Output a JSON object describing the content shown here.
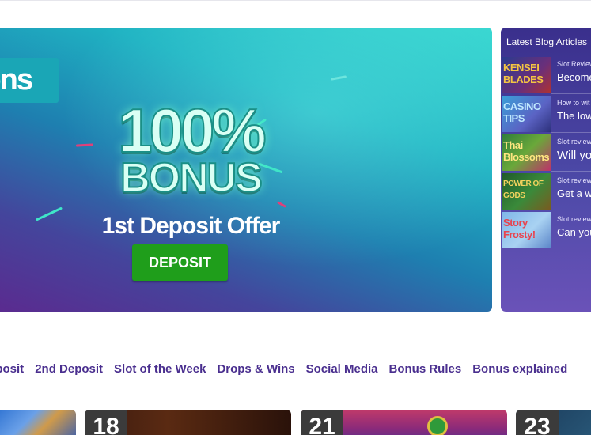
{
  "banner": {
    "ribbon_text": "ons",
    "bonus_percent": "100%",
    "bonus_word": "BONUS",
    "offer_text": "1st Deposit Offer",
    "deposit_button": "DEPOSIT"
  },
  "blog": {
    "title": "Latest Blog Articles",
    "items": [
      {
        "thumb_text": "KENSEI BLADES",
        "category": "Slot Review",
        "headline": "Become"
      },
      {
        "thumb_text": "CASINO TIPS",
        "category": "How to wit",
        "headline": "The low"
      },
      {
        "thumb_text": "Thai Blossoms",
        "category": "Slot review",
        "headline": "Will yo"
      },
      {
        "thumb_text": "POWER OF GODS",
        "category": "Slot review",
        "headline": "Get a wi"
      },
      {
        "thumb_text": "Story Frosty!",
        "category": "Slot review",
        "headline": "Can you"
      }
    ]
  },
  "tabs": [
    "eposit",
    "2nd Deposit",
    "Slot of the Week",
    "Drops & Wins",
    "Social Media",
    "Bonus Rules",
    "Bonus explained"
  ],
  "cards": [
    {
      "number": ""
    },
    {
      "number": "18"
    },
    {
      "number": "21"
    },
    {
      "number": "23"
    }
  ],
  "colors": {
    "tab_text": "#4a2f8f",
    "deposit_button": "#1f9e1b",
    "blog_panel": "#3a2f8c"
  }
}
